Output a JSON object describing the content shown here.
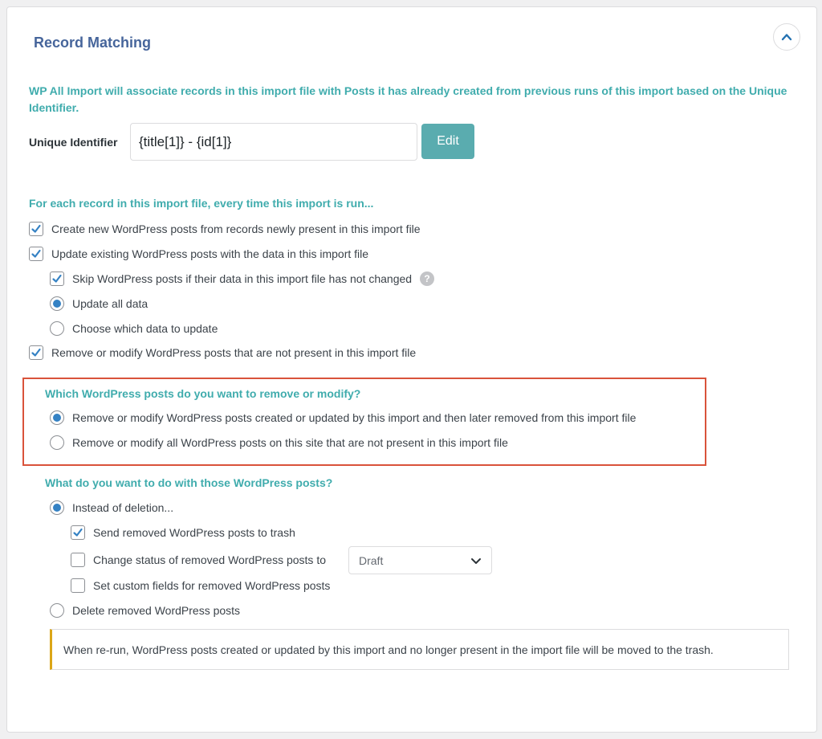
{
  "panel": {
    "title": "Record Matching",
    "collapse_icon": "chevron-up-icon"
  },
  "intro": "WP All Import will associate records in this import file with Posts it has already created from previous runs of this import based on the Unique Identifier.",
  "unique_identifier": {
    "label": "Unique Identifier",
    "value": "{title[1]} - {id[1]}",
    "edit_label": "Edit"
  },
  "each_record": {
    "heading": "For each record in this import file, every time this import is run...",
    "create_new": {
      "label": "Create new WordPress posts from records newly present in this import file",
      "checked": true
    },
    "update_existing": {
      "label": "Update existing WordPress posts with the data in this import file",
      "checked": true
    },
    "skip_unchanged": {
      "label": "Skip WordPress posts if their data in this import file has not changed",
      "checked": true,
      "help": "?"
    },
    "update_all": {
      "label": "Update all data",
      "selected": true
    },
    "choose_data": {
      "label": "Choose which data to update",
      "selected": false
    },
    "remove_modify": {
      "label": "Remove or modify WordPress posts that are not present in this import file",
      "checked": true
    }
  },
  "which_posts": {
    "heading": "Which WordPress posts do you want to remove or modify?",
    "option_import": {
      "label": "Remove or modify WordPress posts created or updated by this import and then later removed from this import file",
      "selected": true
    },
    "option_all": {
      "label": "Remove or modify all WordPress posts on this site that are not present in this import file",
      "selected": false
    }
  },
  "what_do": {
    "heading": "What do you want to do with those WordPress posts?",
    "instead_deletion": {
      "label": "Instead of deletion...",
      "selected": true
    },
    "send_trash": {
      "label": "Send removed WordPress posts to trash",
      "checked": true
    },
    "change_status": {
      "label": "Change status of removed WordPress posts to",
      "checked": false
    },
    "status_select": "Draft",
    "custom_fields": {
      "label": "Set custom fields for removed WordPress posts",
      "checked": false
    },
    "delete_removed": {
      "label": "Delete removed WordPress posts",
      "selected": false
    }
  },
  "notice": "When re-run, WordPress posts created or updated by this import and no longer present in the import file will be moved to the trash.",
  "colors": {
    "title": "#46659b",
    "teal": "#40acad",
    "button": "#5aacaf",
    "highlight": "#d9533b",
    "checkbox": "#3582c4",
    "notice_border": "#dba617"
  }
}
